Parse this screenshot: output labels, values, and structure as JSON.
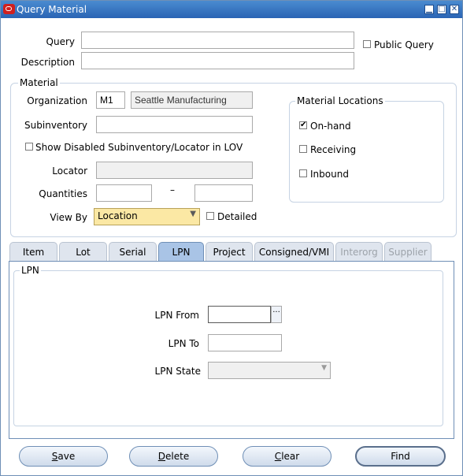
{
  "window": {
    "title": "Query Material"
  },
  "query": {
    "label": "Query",
    "value": ""
  },
  "description": {
    "label": "Description",
    "value": ""
  },
  "public_query": {
    "label": "Public Query",
    "checked": false
  },
  "material": {
    "legend": "Material",
    "organization": {
      "label": "Organization",
      "code": "M1",
      "name": "Seattle Manufacturing"
    },
    "subinventory": {
      "label": "Subinventory",
      "value": ""
    },
    "show_disabled": {
      "label": "Show Disabled Subinventory/Locator in LOV",
      "checked": false
    },
    "locator": {
      "label": "Locator",
      "value": ""
    },
    "quantities": {
      "label": "Quantities",
      "from": "",
      "dash": "–",
      "to": ""
    },
    "view_by": {
      "label": "View By",
      "value": "Location"
    },
    "detailed": {
      "label": "Detailed",
      "checked": false
    }
  },
  "material_locations": {
    "legend": "Material Locations",
    "onhand": {
      "label": "On-hand",
      "checked": true
    },
    "receiving": {
      "label": "Receiving",
      "checked": false
    },
    "inbound": {
      "label": "Inbound",
      "checked": false
    }
  },
  "tabs": [
    {
      "label": "Item",
      "state": "normal"
    },
    {
      "label": "Lot",
      "state": "normal"
    },
    {
      "label": "Serial",
      "state": "normal"
    },
    {
      "label": "LPN",
      "state": "active"
    },
    {
      "label": "Project",
      "state": "normal"
    },
    {
      "label": "Consigned/VMI",
      "state": "normal"
    },
    {
      "label": "Interorg",
      "state": "disabled"
    },
    {
      "label": "Supplier",
      "state": "disabled"
    }
  ],
  "lpn_panel": {
    "legend": "LPN",
    "lpn_from": {
      "label": "LPN From",
      "value": ""
    },
    "lpn_to": {
      "label": "LPN To",
      "value": ""
    },
    "lpn_state": {
      "label": "LPN State",
      "value": ""
    }
  },
  "buttons": {
    "save": {
      "mnemonic": "S",
      "rest": "ave"
    },
    "delete": {
      "mnemonic": "D",
      "rest": "elete"
    },
    "clear": {
      "mnemonic": "C",
      "rest": "lear"
    },
    "find": {
      "label": "Find"
    }
  },
  "colors": {
    "title_bar": "#2a64b4",
    "view_by_bg": "#fbe8a4",
    "active_tab": "#a9c4e6"
  }
}
